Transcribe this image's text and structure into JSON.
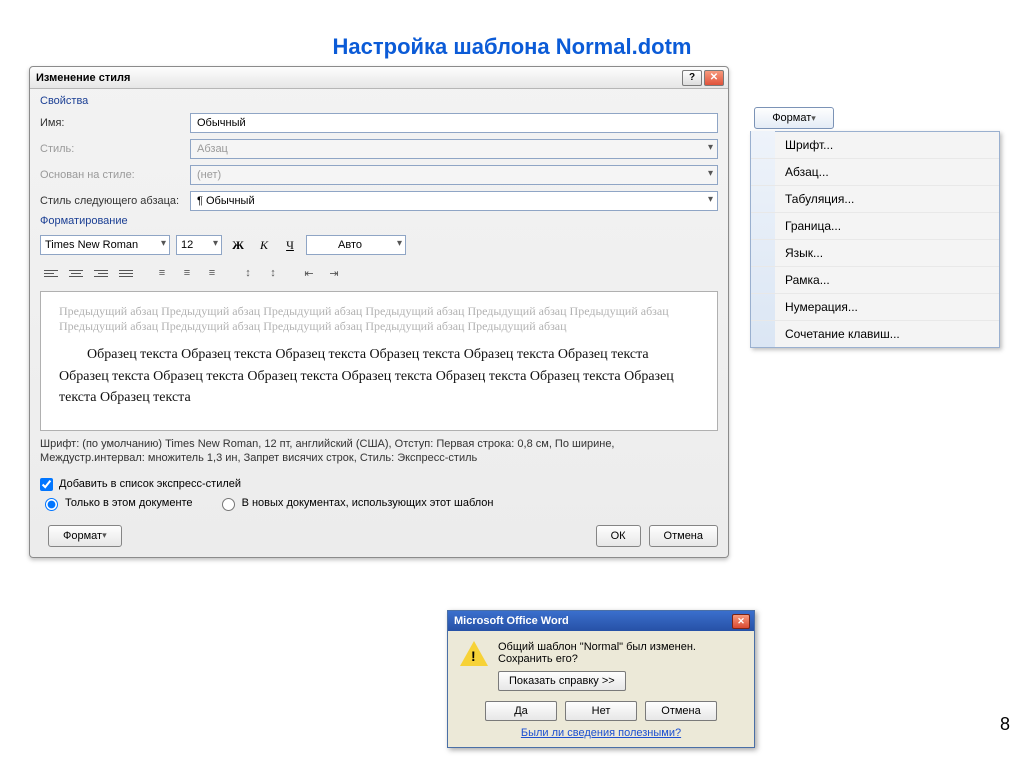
{
  "slide": {
    "title": "Настройка шаблона Normal.dotm",
    "page_number": "8"
  },
  "modify": {
    "title": "Изменение стиля",
    "section_props": "Свойства",
    "labels": {
      "name": "Имя:",
      "style": "Стиль:",
      "based_on": "Основан на стиле:",
      "next": "Стиль следующего абзаца:"
    },
    "values": {
      "name": "Обычный",
      "style": "Абзац",
      "based_on": "(нет)",
      "next": "¶ Обычный"
    },
    "section_format": "Форматирование",
    "font": "Times New Roman",
    "size": "12",
    "bold": "Ж",
    "italic": "К",
    "underline": "Ч",
    "auto_color": "Авто",
    "preview_grey": "Предыдущий абзац Предыдущий абзац Предыдущий абзац Предыдущий абзац Предыдущий абзац Предыдущий абзац Предыдущий абзац Предыдущий абзац Предыдущий абзац Предыдущий абзац Предыдущий абзац",
    "preview_black": "Образец текста Образец текста Образец текста Образец текста Образец текста Образец текста Образец текста Образец текста Образец текста Образец текста Образец текста Образец текста Образец текста Образец текста",
    "summary": "Шрифт: (по умолчанию) Times New Roman, 12 пт, английский (США), Отступ: Первая строка:  0,8 см, По ширине, Междустр.интервал: множитель 1,3 ин, Запрет висячих строк, Стиль: Экспресс-стиль",
    "check_quick": "Добавить в список экспресс-стилей",
    "radio_doc": "Только в этом документе",
    "radio_tpl": "В новых документах, использующих этот шаблон",
    "btn_format": "Формат",
    "btn_ok": "ОК",
    "btn_cancel": "Отмена"
  },
  "format_menu": {
    "button": "Формат",
    "items": [
      "Шрифт...",
      "Абзац...",
      "Табуляция...",
      "Граница...",
      "Язык...",
      "Рамка...",
      "Нумерация...",
      "Сочетание клавиш..."
    ]
  },
  "save_prompt": {
    "title": "Microsoft Office Word",
    "message": "Общий шаблон \"Normal\" был изменен.  Сохранить его?",
    "show_help": "Показать справку >>",
    "yes": "Да",
    "no": "Нет",
    "cancel": "Отмена",
    "feedback": "Были ли сведения полезными?"
  }
}
